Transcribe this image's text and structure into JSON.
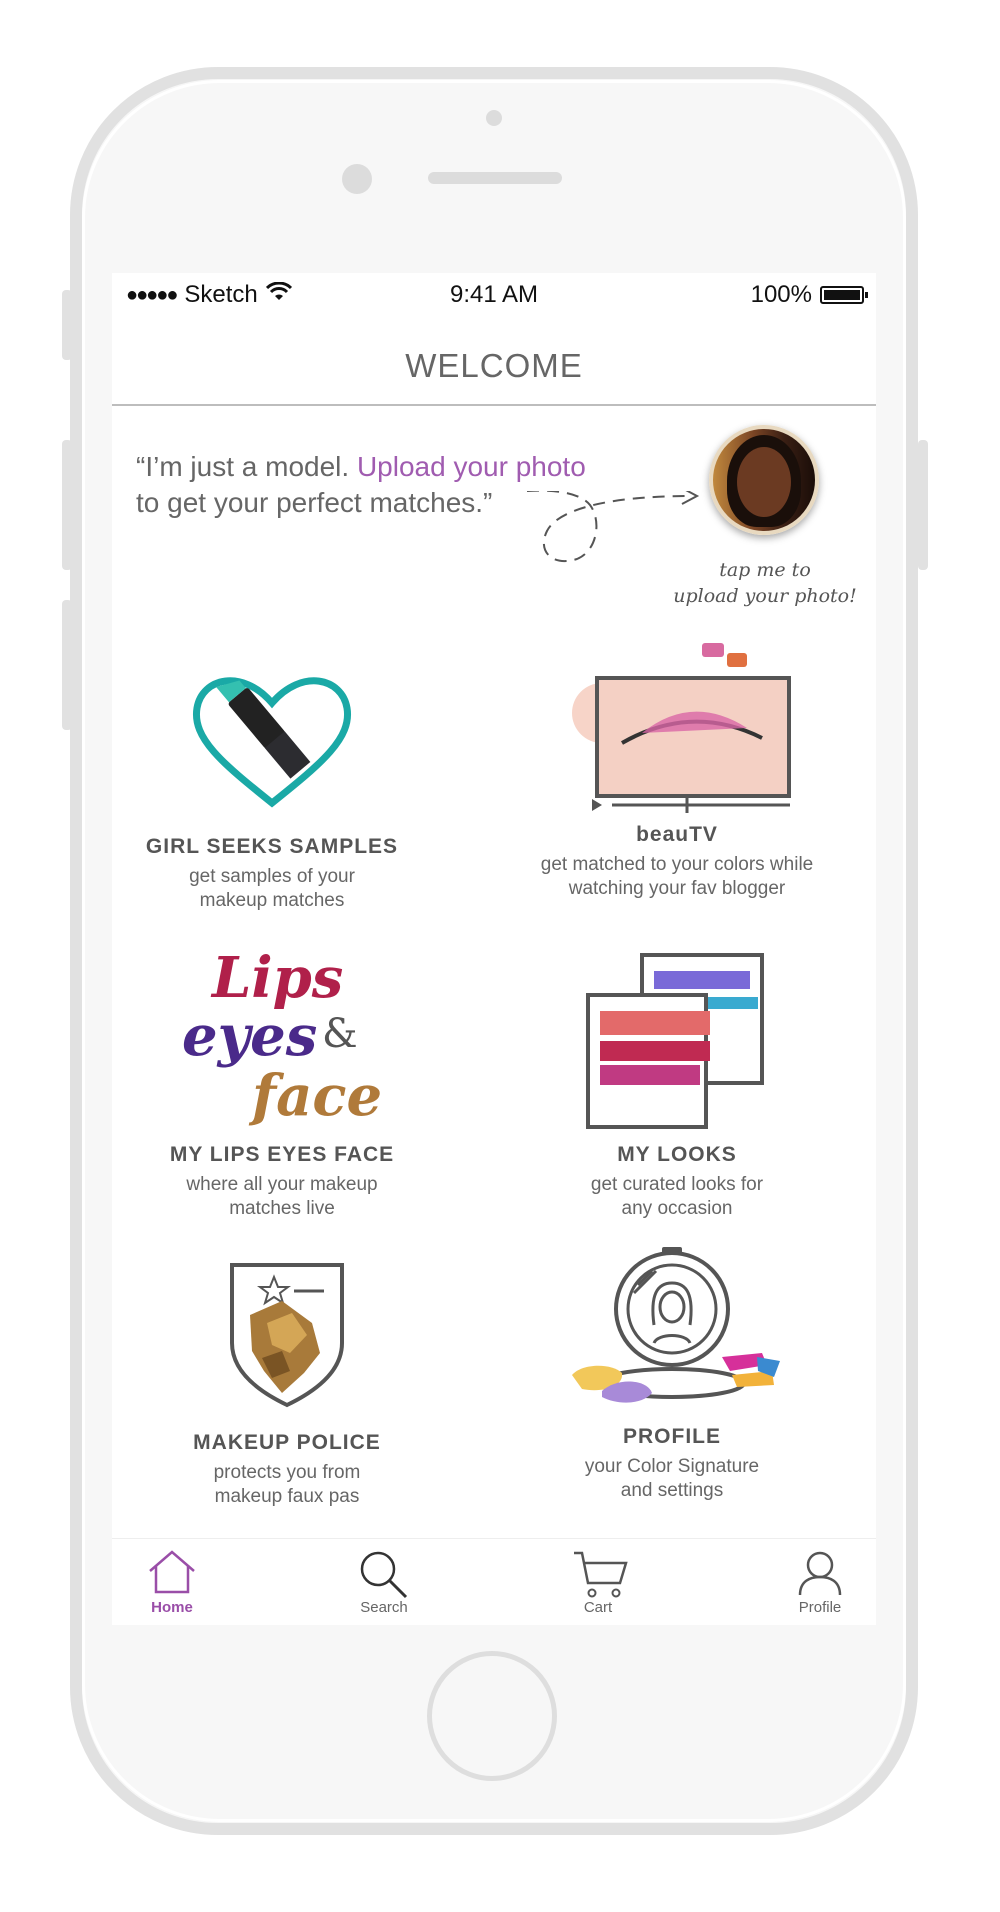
{
  "status_bar": {
    "carrier": "Sketch",
    "time": "9:41 AM",
    "battery": "100%",
    "signal_dots": "●●●●●"
  },
  "header": {
    "title": "WELCOME"
  },
  "intro": {
    "quote_start": "“I’m just a model. ",
    "quote_link": "Upload your photo",
    "quote_end": "to get your perfect matches.”",
    "avatar_caption_line1": "tap me to",
    "avatar_caption_line2": "upload your photo!"
  },
  "tiles": [
    {
      "title": "GIRL SEEKS SAMPLES",
      "desc_line1": "get samples of your",
      "desc_line2": "makeup matches",
      "icon": "heart-lipstick-icon"
    },
    {
      "title": "beauTV",
      "desc_line1": "get matched to your colors while",
      "desc_line2": "watching your fav blogger",
      "icon": "video-player-icon"
    },
    {
      "title": "MY LIPS EYES FACE",
      "desc_line1": "where all your makeup",
      "desc_line2": "matches live",
      "icon": "lips-eyes-face-logo"
    },
    {
      "title": "MY LOOKS",
      "desc_line1": "get curated looks for",
      "desc_line2": "any occasion",
      "icon": "photo-stack-icon"
    },
    {
      "title": "MAKEUP POLICE",
      "desc_line1": "protects you from",
      "desc_line2": "makeup faux pas",
      "icon": "police-badge-icon"
    },
    {
      "title": "PROFILE",
      "desc_line1": "your Color Signature",
      "desc_line2": "and settings",
      "icon": "compact-mirror-icon"
    }
  ],
  "logo_text": {
    "lips": "Lips",
    "eyes": "eyes",
    "amp": "&",
    "face": "face"
  },
  "tab_bar": [
    {
      "label": "Home",
      "icon": "home-icon",
      "active": true
    },
    {
      "label": "Search",
      "icon": "search-icon",
      "active": false
    },
    {
      "label": "Cart",
      "icon": "cart-icon",
      "active": false
    },
    {
      "label": "Profile",
      "icon": "profile-icon",
      "active": false
    }
  ],
  "colors": {
    "accent": "#a05cb0",
    "text": "#666666",
    "divider": "#bdbdbd"
  }
}
